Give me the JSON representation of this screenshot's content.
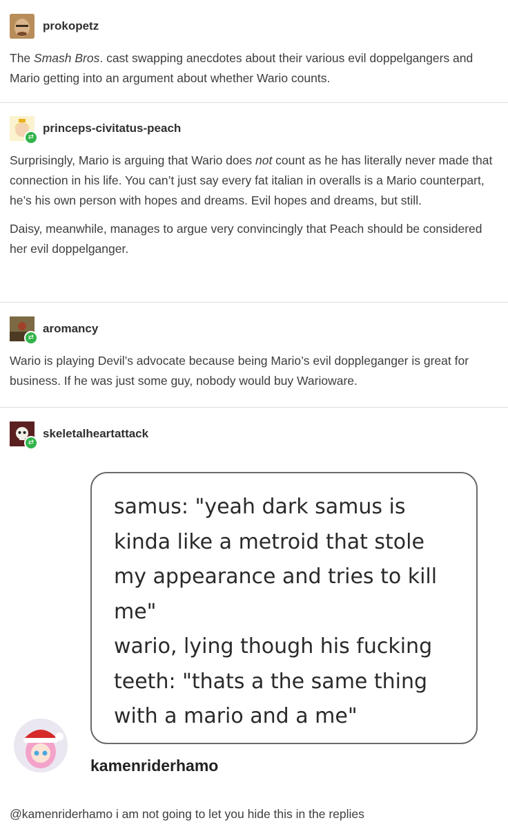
{
  "posts": [
    {
      "username": "prokopetz",
      "text_parts": [
        "The ",
        "Smash Bros",
        ". cast swapping anecdotes about their various evil doppelgangers and Mario getting into an argument about whether Wario counts."
      ]
    },
    {
      "username": "princeps-civitatus-peach",
      "para1_parts": [
        "Surprisingly, Mario is arguing that Wario does ",
        "not",
        " count as he has literally never made that connection in his life. You can’t just say every fat italian in overalls is a Mario counterpart, he’s his own person with hopes and dreams. Evil hopes and dreams, but still."
      ],
      "para2": "Daisy, meanwhile, manages to argue very convincingly that Peach should be considered her evil doppelganger."
    },
    {
      "username": "aromancy",
      "text": "Wario is playing Devil’s advocate because being Mario’s evil doppleganger is great for business. If he was just some guy, nobody would buy Warioware."
    },
    {
      "username": "skeletalheartattack"
    }
  ],
  "embedded_post": {
    "lines": [
      "samus: \"yeah dark samus is",
      "kinda like a metroid that stole",
      "my appearance and tries to kill",
      "me\"",
      "wario, lying though his fucking",
      "teeth: \"thats a the same thing",
      "with a mario and a me\""
    ],
    "username": "kamenriderhamo"
  },
  "footer": {
    "text": "@kamenriderhamo i am not going to let you hide this in the replies"
  },
  "colors": {
    "reblog_badge": "#31b34a",
    "divider": "#dcdcdc"
  },
  "icons": {
    "reblog": "reblog-icon"
  }
}
